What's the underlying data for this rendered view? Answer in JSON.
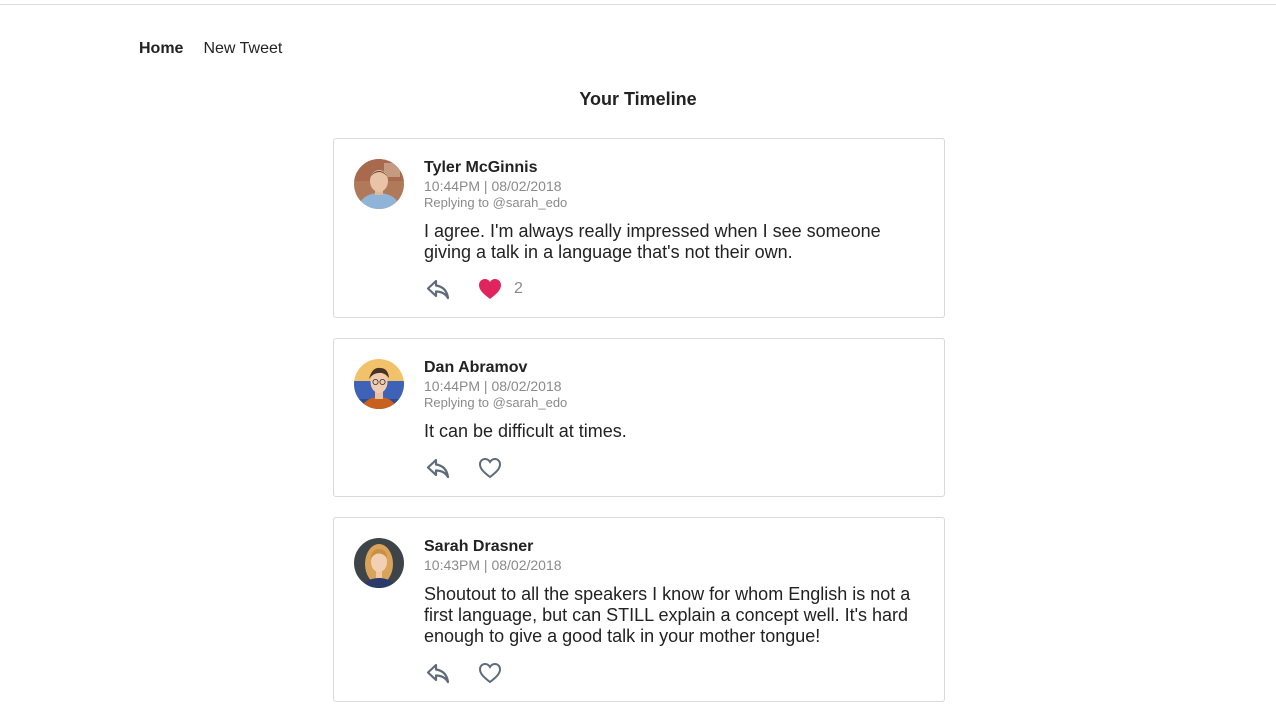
{
  "nav": {
    "home_label": "Home",
    "new_tweet_label": "New Tweet"
  },
  "page": {
    "title": "Your Timeline"
  },
  "colors": {
    "like_active": "#e0245e",
    "icon_gray": "#5f6b7a",
    "meta_gray": "#8a8a8a"
  },
  "tweets": [
    {
      "author": "Tyler McGinnis",
      "timestamp": "10:44PM | 08/02/2018",
      "reply_to": "Replying to @sarah_edo",
      "text": "I agree. I'm always really impressed when I see someone giving a talk in a language that's not their own.",
      "liked": true,
      "like_count": "2",
      "icons": {
        "reply": "reply-icon",
        "like": "heart-filled-icon"
      }
    },
    {
      "author": "Dan Abramov",
      "timestamp": "10:44PM | 08/02/2018",
      "reply_to": "Replying to @sarah_edo",
      "text": "It can be difficult at times.",
      "liked": false,
      "like_count": "",
      "icons": {
        "reply": "reply-icon",
        "like": "heart-outline-icon"
      }
    },
    {
      "author": "Sarah Drasner",
      "timestamp": "10:43PM | 08/02/2018",
      "reply_to": "",
      "text": "Shoutout to all the speakers I know for whom English is not a first language, but can STILL explain a concept well. It's hard enough to give a good talk in your mother tongue!",
      "liked": false,
      "like_count": "",
      "icons": {
        "reply": "reply-icon",
        "like": "heart-outline-icon"
      }
    }
  ]
}
